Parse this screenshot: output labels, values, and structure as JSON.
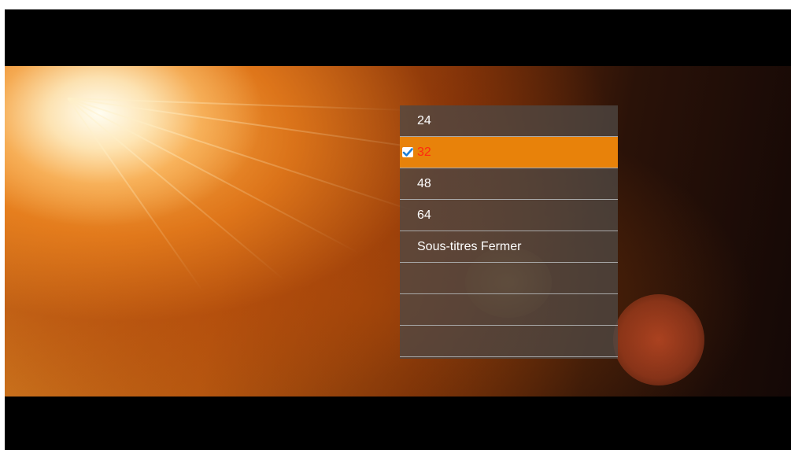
{
  "menu": {
    "items": [
      {
        "label": "24",
        "selected": false
      },
      {
        "label": "32",
        "selected": true
      },
      {
        "label": "48",
        "selected": false
      },
      {
        "label": "64",
        "selected": false
      },
      {
        "label": "Sous-titres Fermer",
        "selected": false
      },
      {
        "label": "",
        "selected": false
      },
      {
        "label": "",
        "selected": false
      },
      {
        "label": "",
        "selected": false
      }
    ]
  },
  "colors": {
    "highlight": "#e8820a",
    "selected_text": "#ff2a10",
    "item_text": "#ffffff",
    "divider": "#a8a8a8",
    "checkbox_check": "#1f7fd6",
    "letterbox": "#000000"
  },
  "icons": {
    "selected_marker": "checkbox-checked-icon"
  }
}
